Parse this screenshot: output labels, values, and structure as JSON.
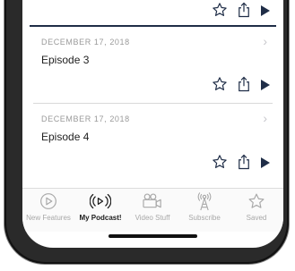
{
  "episodes": [
    {
      "date": "",
      "title": ""
    },
    {
      "date": "DECEMBER 17, 2018",
      "title": "Episode 3"
    },
    {
      "date": "DECEMBER 17, 2018",
      "title": "Episode 4"
    }
  ],
  "tabbar": {
    "tabs": [
      {
        "label": "New Features",
        "icon": "play-circle-icon",
        "active": false
      },
      {
        "label": "My Podcast!",
        "icon": "podcast-broadcast-icon",
        "active": true
      },
      {
        "label": "Video Stuff",
        "icon": "video-camera-icon",
        "active": false
      },
      {
        "label": "Subscribe",
        "icon": "antenna-icon",
        "active": false
      },
      {
        "label": "Saved",
        "icon": "star-icon",
        "active": false
      }
    ]
  },
  "colors": {
    "accent": "#1f2d47",
    "inactive": "#a8a8a8",
    "active": "#1b1b1b"
  }
}
